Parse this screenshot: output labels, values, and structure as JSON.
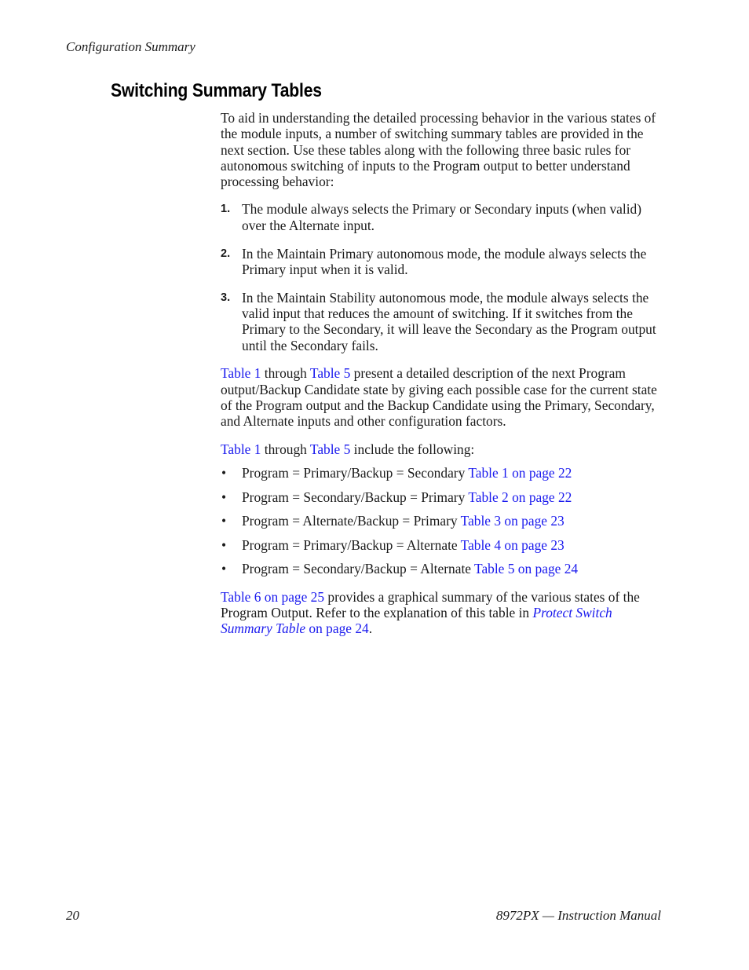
{
  "header": {
    "running_title": "Configuration Summary"
  },
  "section": {
    "title": "Switching Summary Tables"
  },
  "intro": "To aid in understanding the detailed processing behavior in the various states of the module inputs, a number of switching summary tables are provided in the next section. Use these tables along with the following three basic rules for autonomous switching of inputs to the Program output to better understand processing behavior:",
  "rules": [
    {
      "num": "1.",
      "text": "The module always selects the Primary or Secondary inputs (when valid) over the Alternate input."
    },
    {
      "num": "2.",
      "text": "In the Maintain Primary autonomous mode, the module always selects the Primary input when it is valid."
    },
    {
      "num": "3.",
      "text": "In the Maintain Stability autonomous mode, the module always selects the valid input that reduces the amount of switching. If it switches from the Primary to the Secondary, it will leave the Secondary as the Program output until the Secondary fails."
    }
  ],
  "para2": {
    "link1": "Table 1",
    "mid": " through ",
    "link2": "Table 5",
    "rest": " present a detailed description of the next Program output/Backup Candidate state by giving each possible case for the current state of the Program output and the Backup Candidate using the Primary, Secondary, and Alternate inputs and other configuration factors."
  },
  "para3": {
    "link1": "Table 1",
    "mid": " through ",
    "link2": "Table 5",
    "rest": " include the following:"
  },
  "cases": [
    {
      "bullet": "•",
      "text": "Program = Primary/Backup = Secondary ",
      "link": "Table 1 on page 22"
    },
    {
      "bullet": "•",
      "text": "Program = Secondary/Backup = Primary ",
      "link": "Table 2 on page 22"
    },
    {
      "bullet": "•",
      "text": "Program = Alternate/Backup = Primary ",
      "link": "Table 3 on page 23"
    },
    {
      "bullet": "•",
      "text": "Program = Primary/Backup = Alternate ",
      "link": "Table 4 on page 23"
    },
    {
      "bullet": "•",
      "text": "Program = Secondary/Backup = Alternate ",
      "link": "Table 5 on page 24"
    }
  ],
  "para4": {
    "link1": "Table 6 on page 25",
    "text1": " provides a graphical summary of the various states of the Program Output. Refer to the explanation of this table in ",
    "link2": "Protect Switch Summary Table",
    "link3": " on page 24",
    "end": "."
  },
  "footer": {
    "page_number": "20",
    "manual_title": "8972PX — Instruction Manual"
  },
  "colors": {
    "link": "#1a1aee",
    "text": "#1a1a1a"
  }
}
